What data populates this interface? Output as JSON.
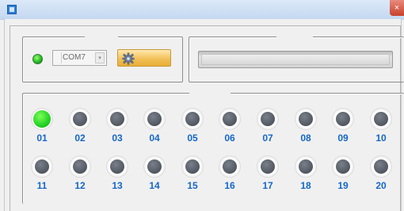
{
  "window": {
    "close_glyph": "×"
  },
  "connection": {
    "led_state": "on",
    "com_port": "COM7",
    "dropdown_icon": "chevron-down-icon",
    "connect_icon": "gear-icon"
  },
  "status": {
    "text": ""
  },
  "ports": [
    {
      "label": "01",
      "active": true
    },
    {
      "label": "02",
      "active": false
    },
    {
      "label": "03",
      "active": false
    },
    {
      "label": "04",
      "active": false
    },
    {
      "label": "05",
      "active": false
    },
    {
      "label": "06",
      "active": false
    },
    {
      "label": "07",
      "active": false
    },
    {
      "label": "08",
      "active": false
    },
    {
      "label": "09",
      "active": false
    },
    {
      "label": "10",
      "active": false
    },
    {
      "label": "11",
      "active": false
    },
    {
      "label": "12",
      "active": false
    },
    {
      "label": "13",
      "active": false
    },
    {
      "label": "14",
      "active": false
    },
    {
      "label": "15",
      "active": false
    },
    {
      "label": "16",
      "active": false
    },
    {
      "label": "17",
      "active": false
    },
    {
      "label": "18",
      "active": false
    },
    {
      "label": "19",
      "active": false
    },
    {
      "label": "20",
      "active": false
    }
  ],
  "colors": {
    "active": "#22d222",
    "inactive": "#555b64",
    "label": "#1467c8"
  }
}
